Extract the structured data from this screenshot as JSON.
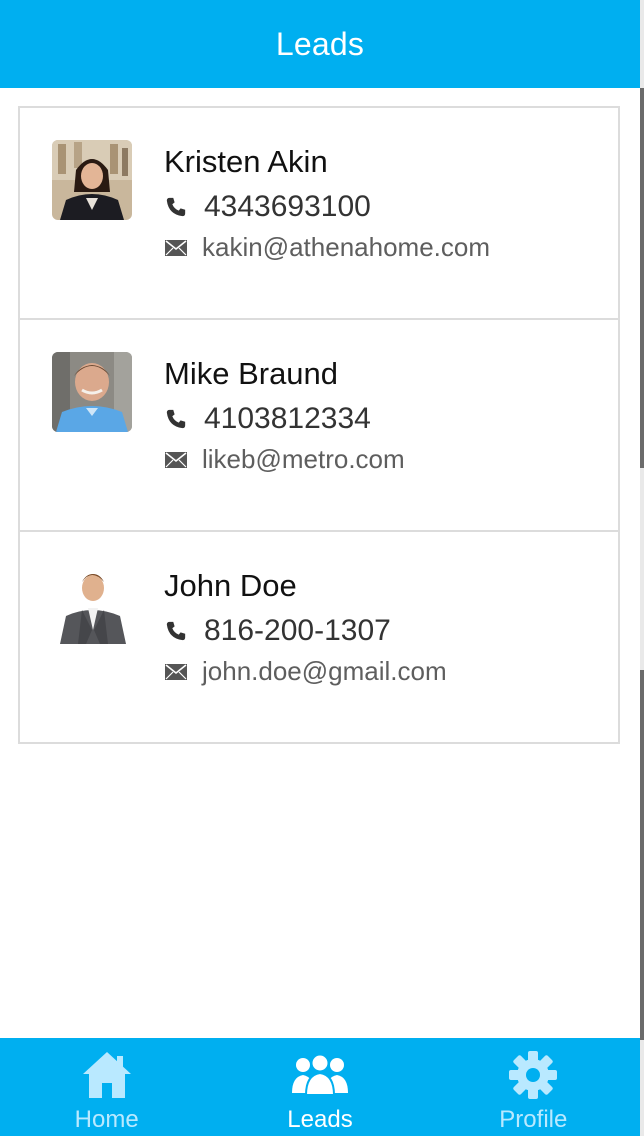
{
  "header": {
    "title": "Leads"
  },
  "colors": {
    "accent": "#00aff0",
    "tab_inactive": "#b9e9ff",
    "tab_active": "#ffffff",
    "divider": "#dcdcdc"
  },
  "leads": [
    {
      "name": "Kristen Akin",
      "phone": "4343693100",
      "email": "kakin@athenahome.com",
      "avatar_icon": "photo-avatar-woman"
    },
    {
      "name": "Mike Braund",
      "phone": "4103812334",
      "email": "likeb@metro.com",
      "avatar_icon": "photo-avatar-man"
    },
    {
      "name": "John Doe",
      "phone": "816-200-1307",
      "email": "john.doe@gmail.com",
      "avatar_icon": "photo-avatar-man-suit"
    }
  ],
  "icons": {
    "phone": "phone-icon",
    "email": "mail-icon"
  },
  "tabbar": {
    "tabs": [
      {
        "label": "Home",
        "icon": "home-icon",
        "active": false
      },
      {
        "label": "Leads",
        "icon": "people-icon",
        "active": true
      },
      {
        "label": "Profile",
        "icon": "gear-icon",
        "active": false
      }
    ]
  }
}
